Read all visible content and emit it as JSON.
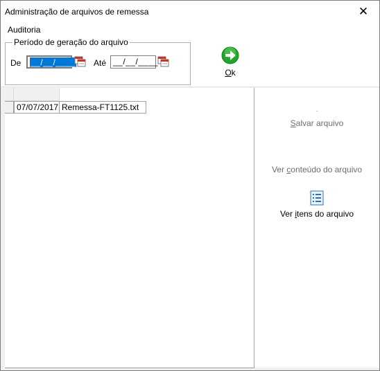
{
  "window": {
    "title": "Administração de arquivos de remessa",
    "close_glyph": "✕"
  },
  "menu": {
    "items": [
      {
        "label": "Auditoria"
      }
    ]
  },
  "period": {
    "legend": "Período de geração do arquivo",
    "from_label": "De",
    "from_value": "__/__/____",
    "to_label": "Até",
    "to_value": "__/__/____"
  },
  "ok": {
    "label_underlined": "O",
    "label_rest": "k",
    "icon": "green-arrow-right-icon"
  },
  "grid": {
    "rows": [
      {
        "date": "07/07/2017",
        "file": "Remessa-FT1125.txt"
      }
    ]
  },
  "actions": {
    "dot": "·",
    "save": {
      "before": "",
      "underlined": "S",
      "after": "alvar arquivo",
      "enabled": false
    },
    "view_content": {
      "before": "Ver ",
      "underlined": "c",
      "after": "onteúdo do arquivo",
      "enabled": false
    },
    "view_items": {
      "before": "Ver ",
      "underlined": "i",
      "after": "tens do arquivo",
      "enabled": true,
      "icon": "list-icon"
    }
  },
  "colors": {
    "selection": "#0078d7",
    "ok_green": "#22a52b"
  }
}
